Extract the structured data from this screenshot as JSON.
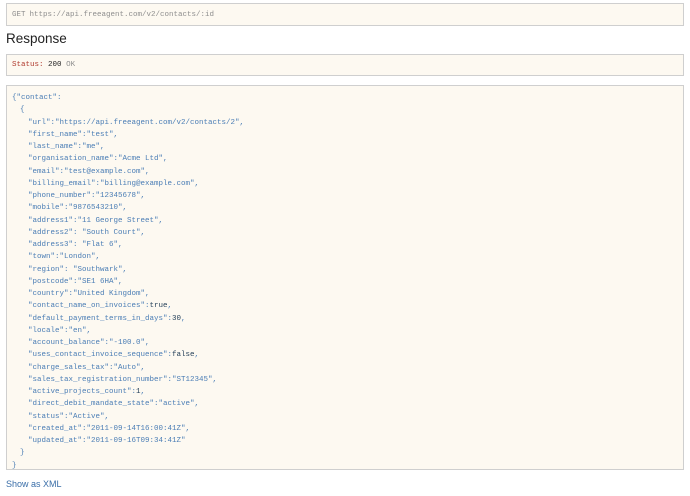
{
  "request": {
    "method": "GET",
    "url": "https://api.freeagent.com/v2/contacts/:id"
  },
  "response": {
    "heading": "Response",
    "status_label": "Status:",
    "status_code": "200",
    "status_text": "OK"
  },
  "json": {
    "open_line": "{\"contact\":",
    "open_brace": "{",
    "close_brace": "}",
    "close_line": "}",
    "fields": [
      {
        "key": "\"url\":",
        "value": "\"https://api.freeagent.com/v2/contacts/2\"",
        "type": "string"
      },
      {
        "key": "\"first_name\":",
        "value": "\"test\"",
        "type": "string"
      },
      {
        "key": "\"last_name\":",
        "value": "\"me\"",
        "type": "string"
      },
      {
        "key": "\"organisation_name\":",
        "value": "\"Acme Ltd\"",
        "type": "string"
      },
      {
        "key": "\"email\":",
        "value": "\"test@example.com\"",
        "type": "string"
      },
      {
        "key": "\"billing_email\":",
        "value": "\"billing@example.com\"",
        "type": "string"
      },
      {
        "key": "\"phone_number\":",
        "value": "\"12345678\"",
        "type": "string"
      },
      {
        "key": "\"mobile\":",
        "value": "\"9876543210\"",
        "type": "string"
      },
      {
        "key": "\"address1\":",
        "value": "\"11 George Street\"",
        "type": "string"
      },
      {
        "key": "\"address2\": ",
        "value": "\"South Court\"",
        "type": "string"
      },
      {
        "key": "\"address3\": ",
        "value": "\"Flat 6\"",
        "type": "string"
      },
      {
        "key": "\"town\":",
        "value": "\"London\"",
        "type": "string"
      },
      {
        "key": "\"region\": ",
        "value": "\"Southwark\"",
        "type": "string"
      },
      {
        "key": "\"postcode\":",
        "value": "\"SE1 6HA\"",
        "type": "string"
      },
      {
        "key": "\"country\":",
        "value": "\"United Kingdom\"",
        "type": "string"
      },
      {
        "key": "\"contact_name_on_invoices\":",
        "value": "true",
        "type": "literal"
      },
      {
        "key": "\"default_payment_terms_in_days\":",
        "value": "30",
        "type": "literal"
      },
      {
        "key": "\"locale\":",
        "value": "\"en\"",
        "type": "string"
      },
      {
        "key": "\"account_balance\":",
        "value": "\"-100.0\"",
        "type": "string"
      },
      {
        "key": "\"uses_contact_invoice_sequence\":",
        "value": "false",
        "type": "literal"
      },
      {
        "key": "\"charge_sales_tax\":",
        "value": "\"Auto\"",
        "type": "string"
      },
      {
        "key": "\"sales_tax_registration_number\":",
        "value": "\"ST12345\"",
        "type": "string"
      },
      {
        "key": "\"active_projects_count\":",
        "value": "1",
        "type": "literal"
      },
      {
        "key": "\"direct_debit_mandate_state\":",
        "value": "\"active\"",
        "type": "string"
      },
      {
        "key": "\"status\":",
        "value": "\"Active\"",
        "type": "string"
      },
      {
        "key": "\"created_at\":",
        "value": "\"2011-09-14T16:00:41Z\"",
        "type": "string"
      },
      {
        "key": "\"updated_at\":",
        "value": "\"2011-09-16T09:34:41Z\"",
        "type": "string"
      }
    ]
  },
  "footer": {
    "xml_link": "Show as XML"
  },
  "colors": {
    "box_background": "#fdf9f1",
    "json_text": "#4a7db5",
    "json_literal": "#1f3b55",
    "status_label": "#b03a2e",
    "link": "#3a6ea8"
  }
}
